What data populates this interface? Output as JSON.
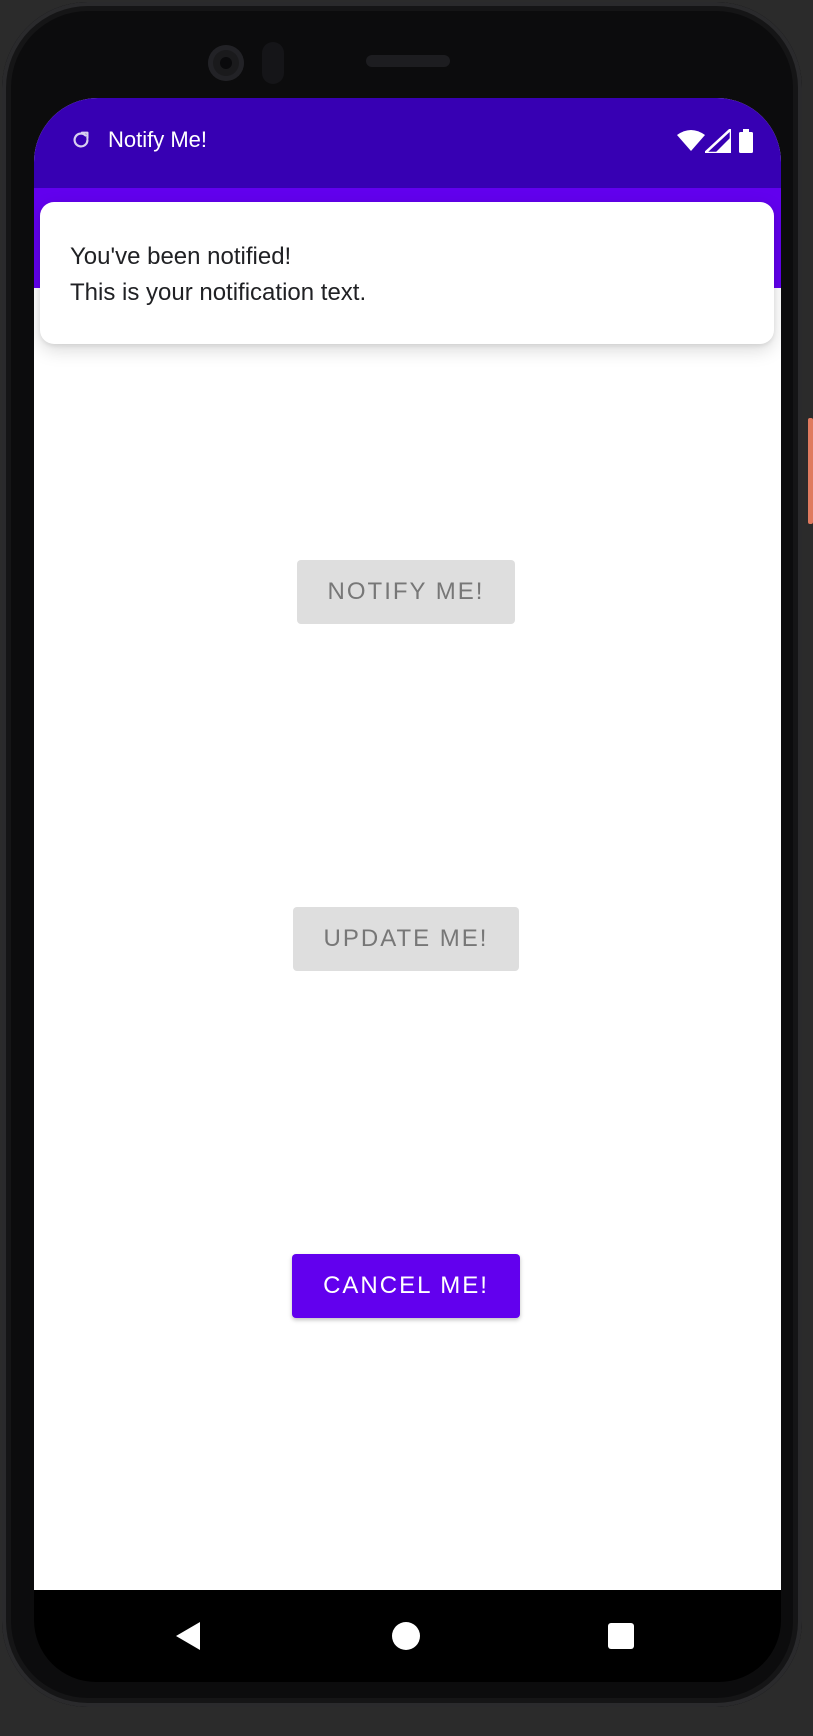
{
  "status_bar": {
    "app_title": "Notify Me!",
    "sync_icon": "sync-icon",
    "wifi_icon": "wifi-icon",
    "signal_icon": "signal-icon",
    "battery_icon": "battery-icon"
  },
  "notification": {
    "title": "You've been notified!",
    "text": "This is your notification text."
  },
  "buttons": {
    "notify_label": "NOTIFY ME!",
    "update_label": "UPDATE ME!",
    "cancel_label": "CANCEL ME!"
  },
  "nav": {
    "back_icon": "back-icon",
    "home_icon": "home-icon",
    "recents_icon": "recents-icon"
  },
  "colors": {
    "status_bar": "#3700b3",
    "action_bar": "#6200ee",
    "primary": "#6200ee",
    "disabled_bg": "#dedede",
    "disabled_text": "#777777"
  }
}
